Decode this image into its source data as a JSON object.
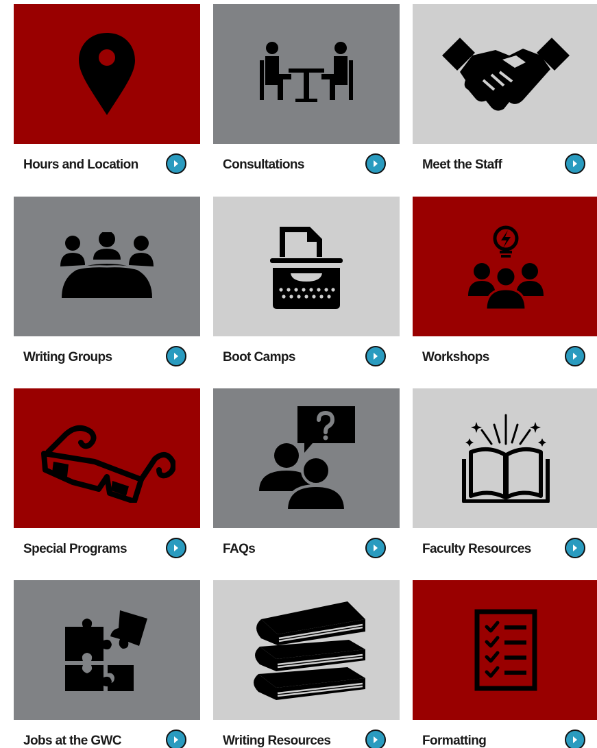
{
  "colors": {
    "red": "#990000",
    "dark_gray": "#808285",
    "light_gray": "#cfcfcf",
    "arrow_teal": "#2a9bbf",
    "icon_black": "#000000"
  },
  "tiles": [
    {
      "label": "Hours and Location",
      "icon": "map-pin-icon",
      "bg": "#990000"
    },
    {
      "label": "Consultations",
      "icon": "meeting-table-icon",
      "bg": "#808285"
    },
    {
      "label": "Meet the Staff",
      "icon": "handshake-icon",
      "bg": "#cfcfcf"
    },
    {
      "label": "Writing Groups",
      "icon": "group-table-icon",
      "bg": "#808285"
    },
    {
      "label": "Boot Camps",
      "icon": "typewriter-icon",
      "bg": "#cfcfcf"
    },
    {
      "label": "Workshops",
      "icon": "lightbulb-team-icon",
      "bg": "#990000"
    },
    {
      "label": "Special Programs",
      "icon": "3d-glasses-icon",
      "bg": "#990000"
    },
    {
      "label": "FAQs",
      "icon": "question-bubble-people-icon",
      "bg": "#808285"
    },
    {
      "label": "Faculty Resources",
      "icon": "open-book-sparkle-icon",
      "bg": "#cfcfcf"
    },
    {
      "label": "Jobs at the GWC",
      "icon": "puzzle-pieces-icon",
      "bg": "#808285"
    },
    {
      "label": "Writing Resources",
      "icon": "book-stack-icon",
      "bg": "#cfcfcf"
    },
    {
      "label": "Formatting",
      "icon": "checklist-icon",
      "bg": "#990000"
    }
  ],
  "arrow_icon": "chevron-right-circle-icon"
}
